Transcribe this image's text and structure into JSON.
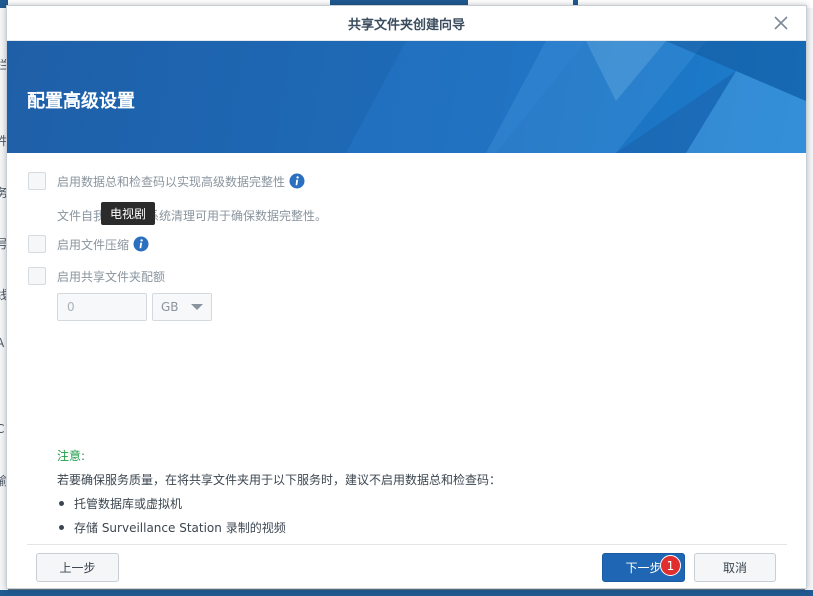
{
  "background": {
    "left_edge_chars": [
      "拦",
      "件",
      "务",
      "号",
      "线",
      "A",
      "C",
      "偷"
    ]
  },
  "dialog": {
    "title": "共享文件夹创建向导",
    "close_icon": "close-icon",
    "heading": "配置高级设置"
  },
  "options": {
    "checksum": {
      "label": "启用数据总和检查码以实现高级数据完整性",
      "checked": false,
      "icon": "info-icon"
    },
    "checksum_desc": "文件自我修复和文件系统清理可用于确保数据完整性。",
    "checksum_desc_visible_start": "文件自我",
    "checksum_desc_visible_end": "件系统清理可用于确保数据完整性。",
    "compression": {
      "label": "启用文件压缩",
      "checked": false,
      "icon": "info-icon"
    },
    "quota": {
      "label": "启用共享文件夹配额",
      "checked": false,
      "value": "0",
      "unit": "GB"
    }
  },
  "tooltip": {
    "text": "电视剧"
  },
  "note": {
    "title": "注意:",
    "text": "若要确保服务质量，在将共享文件夹用于以下服务时，建议不启用数据总和检查码：",
    "items": [
      "托管数据库或虚拟机",
      "存储 Surveillance Station 录制的视频"
    ]
  },
  "buttons": {
    "prev": "上一步",
    "next": "下一步",
    "cancel": "取消",
    "next_badge": "1"
  },
  "colors": {
    "banner": "#1d6bb8",
    "primary_button": "#1f66b5",
    "note_title": "#1e9b48",
    "badge": "#e02d2d",
    "info_icon": "#2a6fc0"
  }
}
